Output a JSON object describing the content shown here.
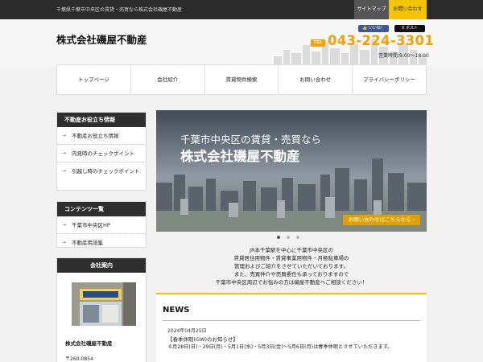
{
  "topbar": {
    "tagline": "千葉県千葉市中央区の賃貸・売買なら株式会社磯屋不動産",
    "sitemap": "サイトマップ",
    "contact": "お問い合わせ"
  },
  "header": {
    "logo": "株式会社磯屋不動産",
    "facebook_like": "👍 いいね！",
    "twitter_post": "X ポスト",
    "tel_label": "TEL",
    "tel_number": "043-224-3301",
    "hours": "営業時間/9:00〜18:00"
  },
  "nav": {
    "items": [
      "トップページ",
      "会社紹介",
      "賃貸物件検索",
      "お問い合わせ",
      "プライバシーポリシー"
    ]
  },
  "sidebar": {
    "useful": {
      "heading": "不動産お役立ち情報",
      "items": [
        "不動産お役立ち情報",
        "内見時のチェックポイント",
        "引越し時のチェックポイント"
      ]
    },
    "contents": {
      "heading": "コンテンツ一覧",
      "items": [
        "千葉市中央区HP",
        "不動産用語集"
      ]
    },
    "company": {
      "heading": "会社案内",
      "name": "株式会社磯屋不動産",
      "zip": "〒260-0854"
    },
    "arrow": "→"
  },
  "hero": {
    "line1": "千葉市中央区の賃貸・売買なら",
    "line2": "株式会社磯屋不動産",
    "cta": "お問い合わせはこちらから ›",
    "slide_count": 3,
    "active_slide": 0
  },
  "intro": {
    "lines": [
      "JR本千葉駅を中心に千葉市中央区の",
      "賃貸居住用物件・賃貸事業用物件・月極駐車場の",
      "管理およびご紹介をさせていただいております。",
      "また、売買仲介や売買委任も承っておりますので",
      "千葉市中央区周辺でお悩みの方は磯屋不動産へご相談ください！"
    ]
  },
  "news": {
    "title": "NEWS",
    "date": "2024年04月25日",
    "headline": "【春季休暇(GW)のお知らせ】",
    "body": "４月28日(日)・29日(月)・5月1日(水)・5月3日(金)～5月6日(月)は春季休暇とさせていただきます。"
  },
  "colors": {
    "accent": "#f5c400",
    "tel": "#f5a100",
    "dark": "#2e2e2e"
  }
}
